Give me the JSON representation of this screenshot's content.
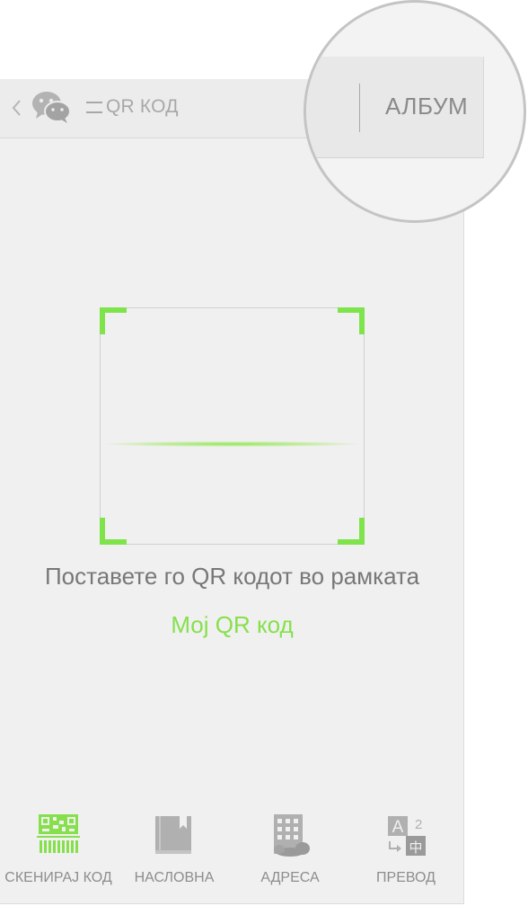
{
  "header": {
    "title": "QR КОД",
    "back_icon": "chevron-left-icon",
    "app_icon": "wechat-icon",
    "menu_icon": "menu-lines-icon"
  },
  "magnifier": {
    "album_label": "АЛБУМ"
  },
  "scanner": {
    "hint": "Поставете го QR кодот во рамката",
    "my_qr_link": "Мој QR код",
    "accent_color": "#7fe34b"
  },
  "bottom_nav": {
    "items": [
      {
        "label": "СКЕНИРАЈ КОД",
        "icon": "qr-scan-icon",
        "active": true
      },
      {
        "label": "НАСЛОВНА",
        "icon": "book-icon",
        "active": false
      },
      {
        "label": "АДРЕСА",
        "icon": "building-icon",
        "active": false
      },
      {
        "label": "ПРЕВОД",
        "icon": "translate-icon",
        "active": false
      }
    ]
  }
}
